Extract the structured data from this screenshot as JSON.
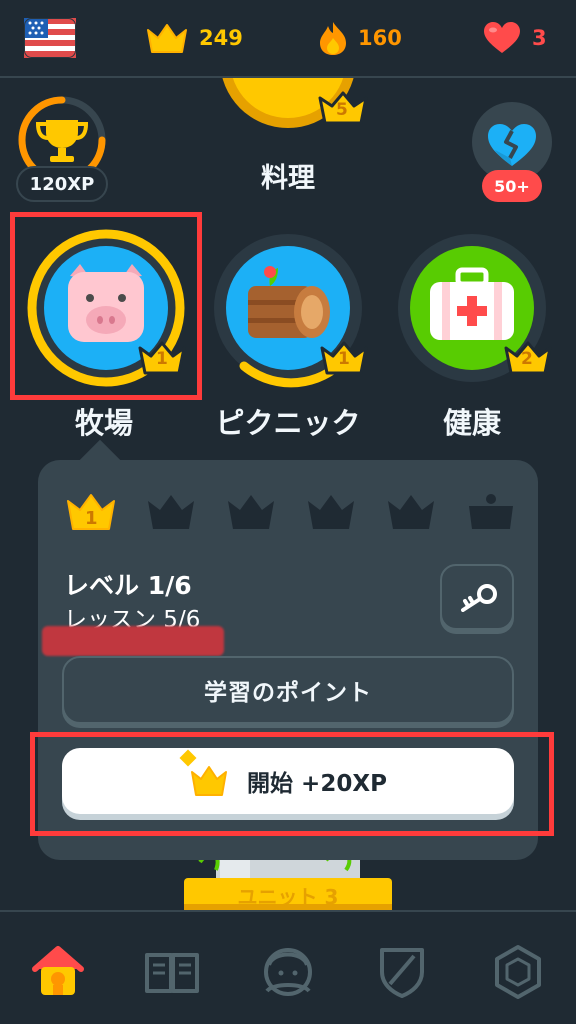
{
  "header": {
    "language_flag_icon": "us-flag-icon",
    "crowns": "249",
    "streak": "160",
    "hearts": "3",
    "colors": {
      "crown": "#ffc800",
      "streak": "#ff9600",
      "heart": "#ff4b4b"
    }
  },
  "section_title": "料理",
  "xp_badge": "120XP",
  "broken_heart_badge": "50+",
  "skills": [
    {
      "label": "牧場",
      "crown_level": "1",
      "icon": "pig-icon"
    },
    {
      "label": "ピクニック",
      "crown_level": "1",
      "icon": "log-icon"
    },
    {
      "label": "健康",
      "crown_level": "2",
      "icon": "first-aid-kit-icon"
    }
  ],
  "top_skill_crown": "5",
  "popup": {
    "active_level": "1",
    "level_text": "レベル 1/6",
    "lesson_text": "レッスン 5/6",
    "tips_label": "学習のポイント",
    "start_label": "開始 +20XP"
  },
  "unit_label": "ユニット 3",
  "nav": [
    "home-icon",
    "stories-icon",
    "profile-icon",
    "leagues-shield-icon",
    "shop-icon"
  ]
}
